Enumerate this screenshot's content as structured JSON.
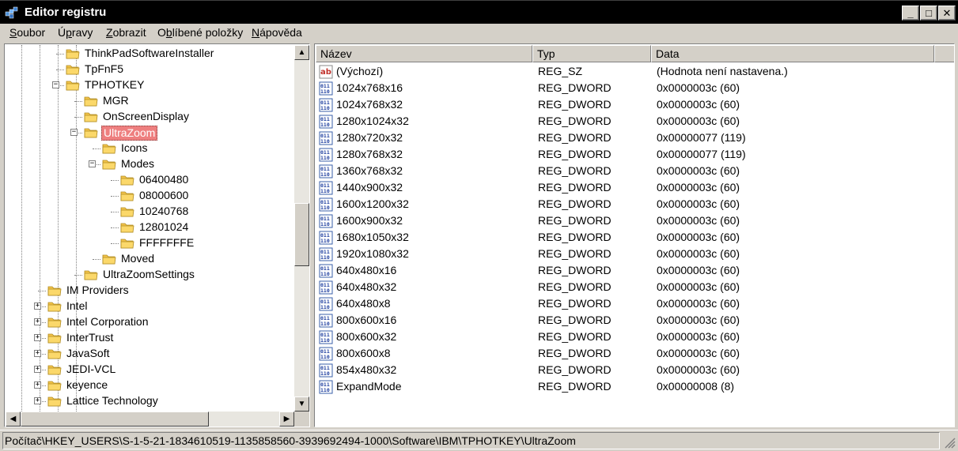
{
  "window": {
    "title": "Editor registru",
    "icon": "regedit-icon"
  },
  "menu": [
    {
      "label": "Soubor",
      "key": "S",
      "rest": "oubor"
    },
    {
      "label": "Úpravy",
      "pre": "Ú",
      "key": "p",
      "rest": "ravy"
    },
    {
      "label": "Zobrazit",
      "key": "Z",
      "rest": "obrazit"
    },
    {
      "label": "Oblíbené položky",
      "pre": "O",
      "key": "b",
      "rest": "líbené položky"
    },
    {
      "label": "Nápověda",
      "key": "N",
      "rest": "ápověda"
    }
  ],
  "tree": {
    "nodes": [
      {
        "label": "ThinkPadSoftwareInstaller"
      },
      {
        "label": "TpFnF5"
      },
      {
        "label": "TPHOTKEY",
        "expander": "−"
      },
      {
        "label": "MGR"
      },
      {
        "label": "OnScreenDisplay"
      },
      {
        "label": "UltraZoom",
        "expander": "−",
        "selected": true
      },
      {
        "label": "Icons"
      },
      {
        "label": "Modes",
        "expander": "−"
      },
      {
        "label": "06400480"
      },
      {
        "label": "08000600"
      },
      {
        "label": "10240768"
      },
      {
        "label": "12801024"
      },
      {
        "label": "FFFFFFFE"
      },
      {
        "label": "Moved"
      },
      {
        "label": "UltraZoomSettings"
      },
      {
        "label": "IM Providers"
      },
      {
        "label": "Intel",
        "expander": "+"
      },
      {
        "label": "Intel Corporation",
        "expander": "+"
      },
      {
        "label": "InterTrust",
        "expander": "+"
      },
      {
        "label": "JavaSoft",
        "expander": "+"
      },
      {
        "label": "JEDI-VCL",
        "expander": "+"
      },
      {
        "label": "keyence",
        "expander": "+"
      },
      {
        "label": "Lattice Technology",
        "expander": "+"
      }
    ]
  },
  "list": {
    "columns": [
      "Název",
      "Typ",
      "Data"
    ],
    "rows": [
      {
        "name": "(Výchozí)",
        "type": "REG_SZ",
        "data": "(Hodnota není nastavena.)",
        "icon": "string-value-icon"
      },
      {
        "name": "1024x768x16",
        "type": "REG_DWORD",
        "data": "0x0000003c (60)",
        "icon": "binary-value-icon"
      },
      {
        "name": "1024x768x32",
        "type": "REG_DWORD",
        "data": "0x0000003c (60)",
        "icon": "binary-value-icon"
      },
      {
        "name": "1280x1024x32",
        "type": "REG_DWORD",
        "data": "0x0000003c (60)",
        "icon": "binary-value-icon"
      },
      {
        "name": "1280x720x32",
        "type": "REG_DWORD",
        "data": "0x00000077 (119)",
        "icon": "binary-value-icon"
      },
      {
        "name": "1280x768x32",
        "type": "REG_DWORD",
        "data": "0x00000077 (119)",
        "icon": "binary-value-icon"
      },
      {
        "name": "1360x768x32",
        "type": "REG_DWORD",
        "data": "0x0000003c (60)",
        "icon": "binary-value-icon"
      },
      {
        "name": "1440x900x32",
        "type": "REG_DWORD",
        "data": "0x0000003c (60)",
        "icon": "binary-value-icon"
      },
      {
        "name": "1600x1200x32",
        "type": "REG_DWORD",
        "data": "0x0000003c (60)",
        "icon": "binary-value-icon"
      },
      {
        "name": "1600x900x32",
        "type": "REG_DWORD",
        "data": "0x0000003c (60)",
        "icon": "binary-value-icon"
      },
      {
        "name": "1680x1050x32",
        "type": "REG_DWORD",
        "data": "0x0000003c (60)",
        "icon": "binary-value-icon"
      },
      {
        "name": "1920x1080x32",
        "type": "REG_DWORD",
        "data": "0x0000003c (60)",
        "icon": "binary-value-icon"
      },
      {
        "name": "640x480x16",
        "type": "REG_DWORD",
        "data": "0x0000003c (60)",
        "icon": "binary-value-icon"
      },
      {
        "name": "640x480x32",
        "type": "REG_DWORD",
        "data": "0x0000003c (60)",
        "icon": "binary-value-icon"
      },
      {
        "name": "640x480x8",
        "type": "REG_DWORD",
        "data": "0x0000003c (60)",
        "icon": "binary-value-icon"
      },
      {
        "name": "800x600x16",
        "type": "REG_DWORD",
        "data": "0x0000003c (60)",
        "icon": "binary-value-icon"
      },
      {
        "name": "800x600x32",
        "type": "REG_DWORD",
        "data": "0x0000003c (60)",
        "icon": "binary-value-icon"
      },
      {
        "name": "800x600x8",
        "type": "REG_DWORD",
        "data": "0x0000003c (60)",
        "icon": "binary-value-icon"
      },
      {
        "name": "854x480x32",
        "type": "REG_DWORD",
        "data": "0x0000003c (60)",
        "icon": "binary-value-icon"
      },
      {
        "name": "ExpandMode",
        "type": "REG_DWORD",
        "data": "0x00000008 (8)",
        "icon": "binary-value-icon"
      }
    ]
  },
  "status": {
    "path": "Počítač\\HKEY_USERS\\S-1-5-21-1834610519-1135858560-3939692494-1000\\Software\\IBM\\TPHOTKEY\\UltraZoom"
  },
  "colors": {
    "selection": "#ee7f7f",
    "folder": "#f3c44a",
    "titlebar": "#000000",
    "chrome": "#d4d0c8"
  }
}
